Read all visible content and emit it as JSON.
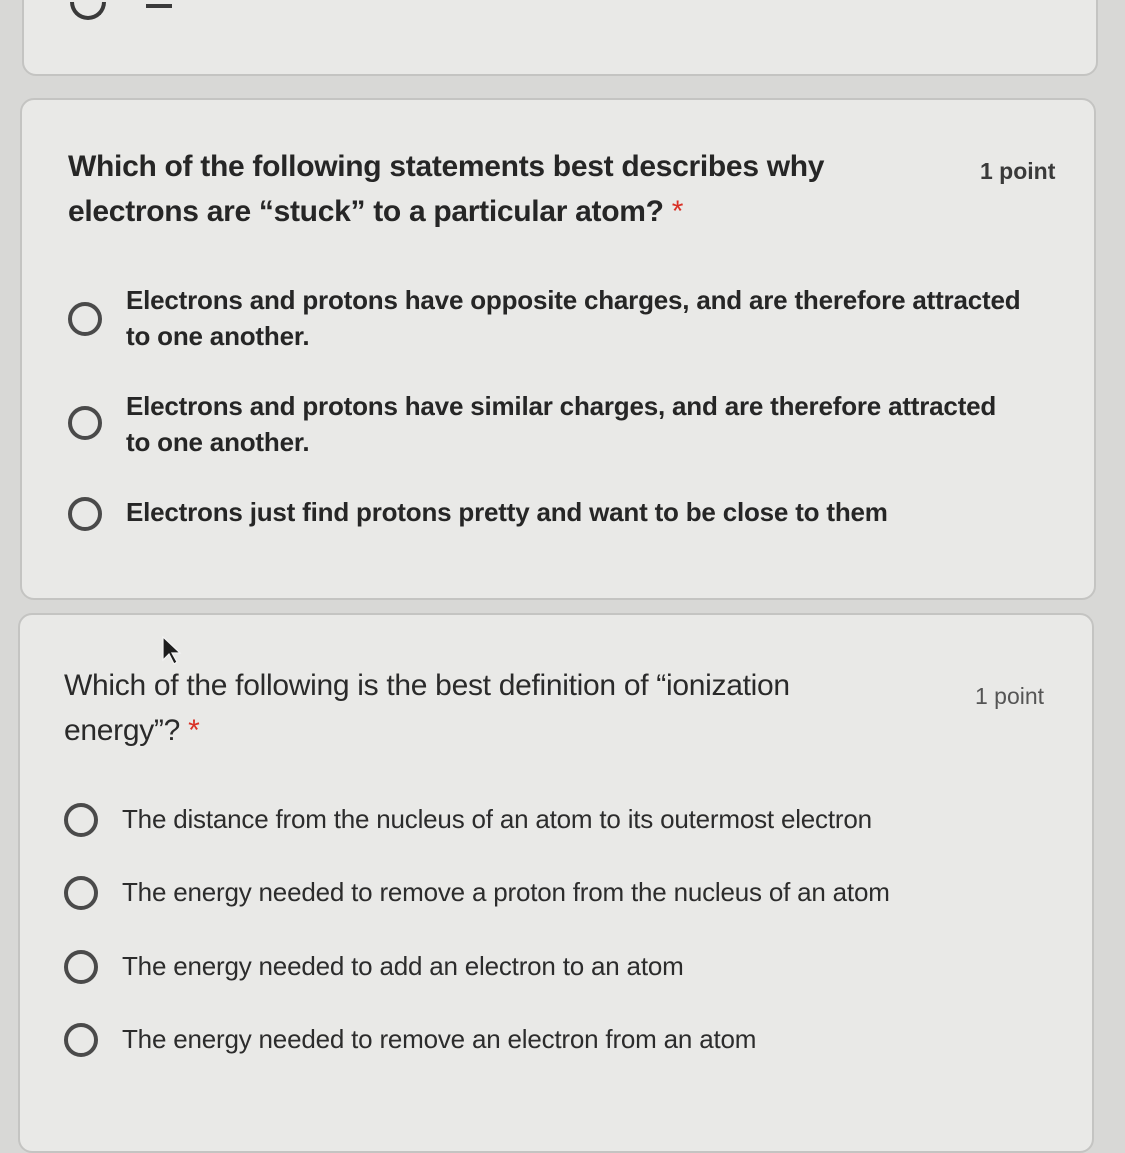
{
  "questions": [
    {
      "text": "Which of the following statements best describes why electrons are “stuck” to a particular atom?",
      "required_marker": "*",
      "points": "1 point",
      "options": [
        {
          "label": "Electrons and protons have opposite charges, and are therefore attracted to one another."
        },
        {
          "label": "Electrons and protons have similar charges, and are therefore attracted to one another."
        },
        {
          "label": "Electrons just find protons pretty and want to be close to them"
        }
      ]
    },
    {
      "text": "Which of the following is the best definition of “ionization energy”?",
      "required_marker": "*",
      "points": "1 point",
      "options": [
        {
          "label": "The distance from the nucleus of an atom to its outermost electron"
        },
        {
          "label": "The energy needed to remove a proton from the nucleus of an atom"
        },
        {
          "label": "The energy needed to add an electron to an atom"
        },
        {
          "label": "The energy needed to remove an electron from an atom"
        }
      ]
    }
  ],
  "colors": {
    "background": "#d8d8d6",
    "card": "#e9e9e7",
    "required_star": "#d93025"
  }
}
